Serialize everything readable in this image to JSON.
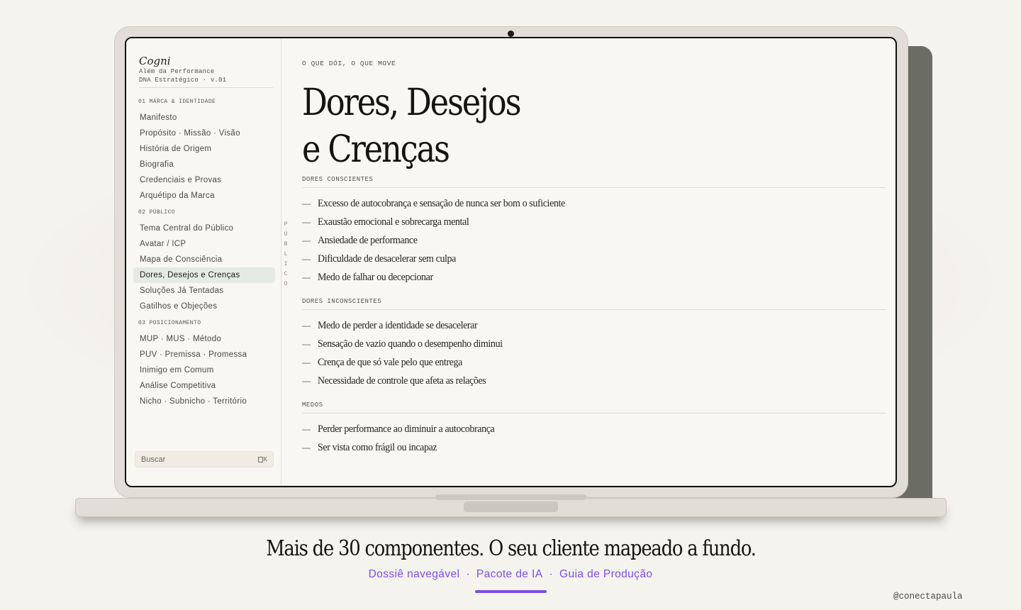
{
  "brand": {
    "name": "Cogni",
    "tagline": "Além da Performance",
    "version": "DNA Estratégico · v.01"
  },
  "sidebar": {
    "sections": [
      {
        "title": "01 MARCA & IDENTIDADE",
        "items": [
          "Manifesto",
          "Propósito · Missão · Visão",
          "História de Origem",
          "Biografia",
          "Credenciais e Provas",
          "Arquétipo da Marca"
        ]
      },
      {
        "title": "02 PÚBLICO",
        "items": [
          "Tema Central do Público",
          "Avatar / ICP",
          "Mapa de Consciência",
          "Dores, Desejos e Crenças",
          "Soluções Já Tentadas",
          "Gatilhos e Objeções"
        ]
      },
      {
        "title": "03 POSICIONAMENTO",
        "items": [
          "MUP · MUS · Método",
          "PUV · Premissa · Promessa",
          "Inimigo em Comum",
          "Análise Competitiva",
          "Nicho · Subnicho · Território"
        ]
      }
    ],
    "active_item": "Dores, Desejos e Crenças",
    "search": {
      "placeholder": "Buscar",
      "shortcut": "K"
    }
  },
  "rail": [
    "P",
    "Ú",
    "B",
    "L",
    "I",
    "C",
    "O"
  ],
  "main": {
    "eyebrow": "O QUE DÓI, O QUE MOVE",
    "title_line1": "Dores, Desejos",
    "title_line2": "e Crenças",
    "groups": [
      {
        "title": "DORES CONSCIENTES",
        "items": [
          "Excesso de autocobrança e sensação de nunca ser bom o suficiente",
          "Exaustão emocional e sobrecarga mental",
          "Ansiedade de performance",
          "Dificuldade de desacelerar sem culpa",
          "Medo de falhar ou decepcionar"
        ]
      },
      {
        "title": "DORES INCONSCIENTES",
        "items": [
          "Medo de perder a identidade se desacelerar",
          "Sensação de vazio quando o desempenho diminui",
          "Crença de que só vale pelo que entrega",
          "Necessidade de controle que afeta as relações"
        ]
      },
      {
        "title": "MEDOS",
        "items": [
          "Perder performance ao diminuir a autocobrança",
          "Ser vista como frágil ou incapaz"
        ]
      }
    ]
  },
  "footer": {
    "tagline": "Mais de 30 componentes. O seu cliente mapeado a fundo.",
    "links": [
      "Dossiê navegável",
      "Pacote de IA",
      "Guia de Produção"
    ],
    "handle": "@conectapaula"
  },
  "colors": {
    "accent": "#7c4ee6",
    "active_bg": "#e5ebe4",
    "background": "#f5f3ee"
  }
}
